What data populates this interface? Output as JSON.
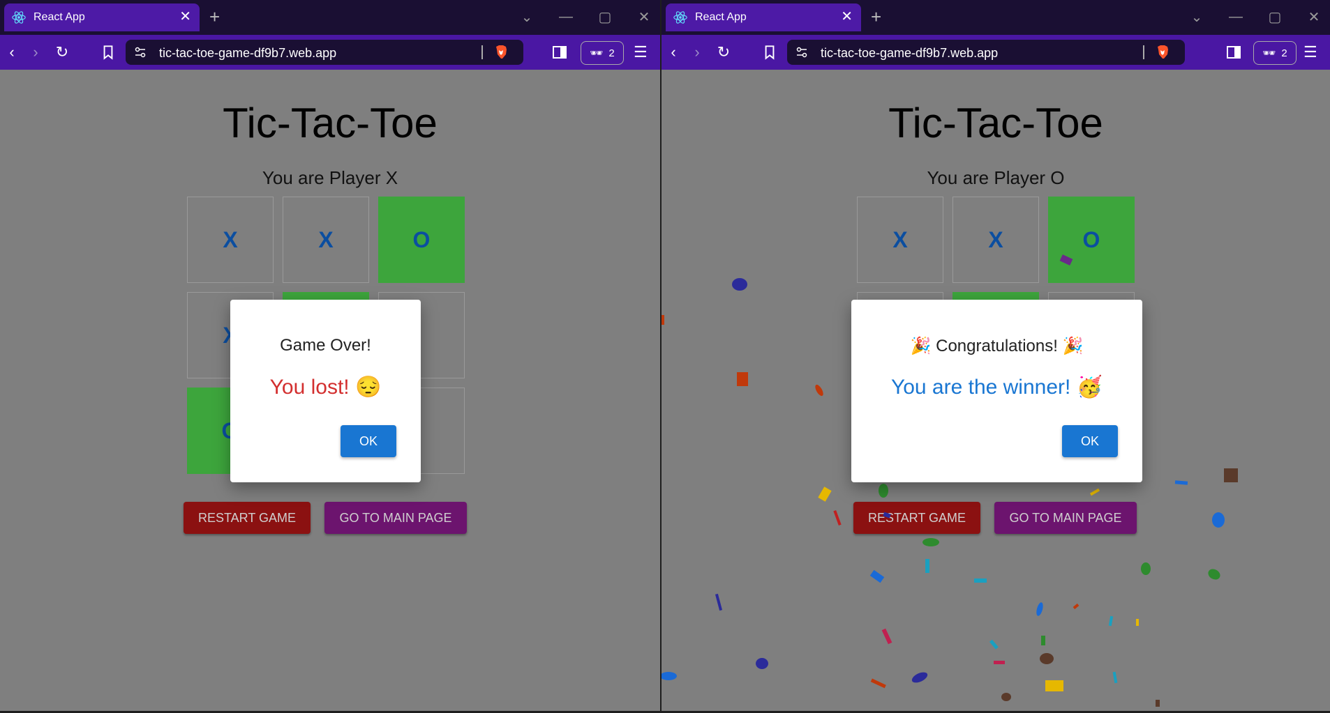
{
  "browser": {
    "tab_title": "React App",
    "url": "tic-tac-toe-game-df9b7.web.app",
    "shields_count": "2",
    "colors": {
      "titlebar": "#1a0f33",
      "toolbar": "#4a17a3",
      "tab_active": "#4d1aa6"
    }
  },
  "icons": {
    "favicon": "react-icon",
    "back": "back-arrow-icon",
    "forward": "forward-arrow-icon",
    "reload": "reload-icon",
    "bookmark": "bookmark-icon",
    "site_settings": "site-settings-icon",
    "brave_shields": "brave-lion-icon",
    "sidebar": "sidebar-icon",
    "extension": "sunglasses-icon",
    "menu": "hamburger-menu-icon"
  },
  "left": {
    "title": "Tic-Tac-Toe",
    "player_text": "You are Player X",
    "board": [
      "X",
      "X",
      "O",
      "X",
      "",
      "",
      "O",
      "",
      ""
    ],
    "restart_label": "RESTART GAME",
    "main_page_label": "GO TO MAIN PAGE",
    "dialog": {
      "title": "Game Over!",
      "message": "You lost! 😔",
      "ok_label": "OK",
      "message_color": "#d32f2f"
    }
  },
  "right": {
    "title": "Tic-Tac-Toe",
    "player_text": "You are Player O",
    "board": [
      "X",
      "X",
      "O",
      "",
      "",
      "",
      "",
      "",
      ""
    ],
    "restart_label": "RESTART GAME",
    "main_page_label": "GO TO MAIN PAGE",
    "dialog": {
      "title": "🎉 Congratulations! 🎉",
      "message": "You are the winner! 🥳",
      "ok_label": "OK",
      "message_color": "#1976d2"
    }
  },
  "colors": {
    "cell_text": "#0b4ea0",
    "winning_cell": "#3da53c",
    "restart_button": "#8b1111",
    "main_page_button": "#6c146e",
    "ok_button": "#1976d2"
  }
}
